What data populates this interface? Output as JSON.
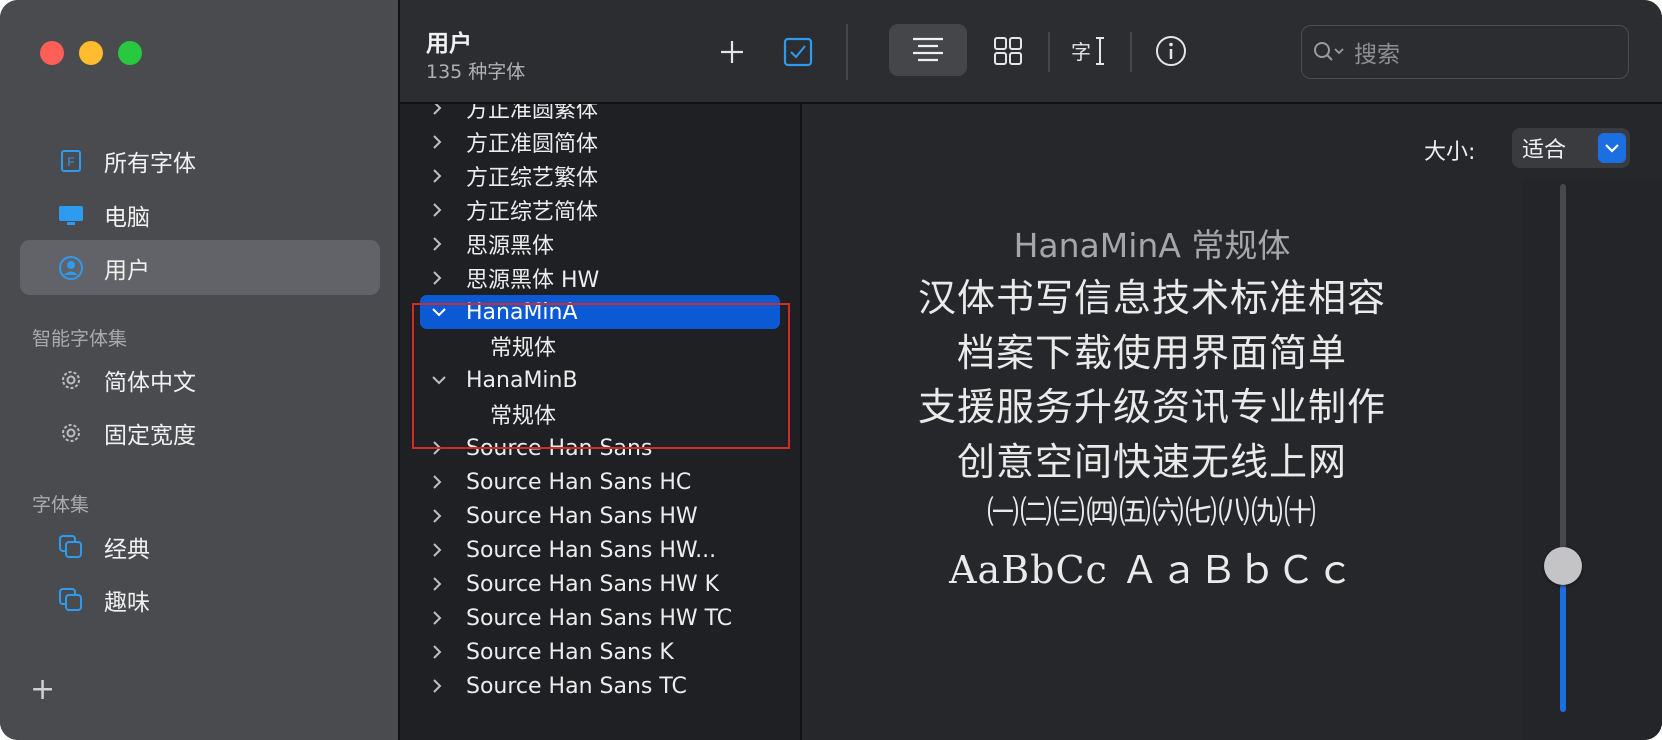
{
  "sidebar": {
    "items": [
      {
        "label": "所有字体",
        "icon": "font-file-icon",
        "active": false
      },
      {
        "label": "电脑",
        "icon": "computer-icon",
        "active": false
      },
      {
        "label": "用户",
        "icon": "user-icon",
        "active": true
      }
    ],
    "smart_section": "智能字体集",
    "smart_items": [
      {
        "label": "简体中文",
        "icon": "gear-icon"
      },
      {
        "label": "固定宽度",
        "icon": "gear-icon"
      }
    ],
    "collections_section": "字体集",
    "collection_items": [
      {
        "label": "经典",
        "icon": "collection-icon"
      },
      {
        "label": "趣味",
        "icon": "collection-icon"
      }
    ],
    "add_label": "+"
  },
  "toolbar": {
    "title": "用户",
    "subtitle": "135 种字体",
    "search_placeholder": "搜索"
  },
  "font_list": [
    {
      "label": "方正准圆繁体",
      "expanded": false
    },
    {
      "label": "方正准圆简体",
      "expanded": false
    },
    {
      "label": "方正综艺繁体",
      "expanded": false
    },
    {
      "label": "方正综艺简体",
      "expanded": false
    },
    {
      "label": "思源黑体",
      "expanded": false
    },
    {
      "label": "思源黑体 HW",
      "expanded": false
    },
    {
      "label": "HanaMinA",
      "expanded": true,
      "selected": true
    },
    {
      "label": "常规体",
      "child": true
    },
    {
      "label": "HanaMinB",
      "expanded": true
    },
    {
      "label": "常规体",
      "child": true
    },
    {
      "label": "Source Han Sans",
      "expanded": false
    },
    {
      "label": "Source Han Sans HC",
      "expanded": false
    },
    {
      "label": "Source Han Sans HW",
      "expanded": false
    },
    {
      "label": "Source Han Sans HW...",
      "expanded": false
    },
    {
      "label": "Source Han Sans HW K",
      "expanded": false
    },
    {
      "label": "Source Han Sans HW TC",
      "expanded": false
    },
    {
      "label": "Source Han Sans K",
      "expanded": false
    },
    {
      "label": "Source Han Sans TC",
      "expanded": false
    }
  ],
  "preview": {
    "size_label": "大小:",
    "size_value": "适合",
    "title": "HanaMinA 常规体",
    "lines": [
      "汉体书写信息技术标准相容",
      "档案下载使用界面简单",
      "支援服务升级资讯专业制作",
      "创意空间快速无线上网",
      "㈠㈡㈢㈣㈤㈥㈦㈧㈨㈩",
      "AaBbCc ＡａＢｂＣｃ"
    ],
    "slider_value": 0.21
  },
  "colors": {
    "accent": "#0b5ad3",
    "traffic_red": "#ff5f57",
    "traffic_yellow": "#febc2e",
    "traffic_green": "#28c840"
  }
}
